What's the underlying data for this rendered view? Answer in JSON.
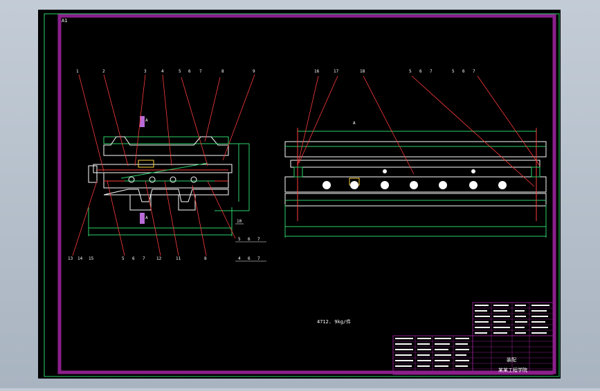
{
  "drawing": {
    "sheet_tag": "A1",
    "section_mark": "A",
    "view_label": "A",
    "weight_note": "4712. 9kg/件",
    "left_callouts_top": [
      "1",
      "2",
      "3",
      "4",
      "5",
      "6",
      "7",
      "8",
      "9"
    ],
    "left_callouts_bottom": [
      "13",
      "14",
      "15",
      "5",
      "6",
      "7",
      "12",
      "11",
      "8",
      "4",
      "6",
      "7"
    ],
    "left_callout_side": "10",
    "left_callout_side_group": [
      "5",
      "6",
      "7"
    ],
    "right_callouts_top": [
      "16",
      "17",
      "18",
      "5",
      "6",
      "7",
      "5",
      "6",
      "7"
    ],
    "title_block": {
      "company": "某某工程学院",
      "drawing_type": "装配"
    }
  },
  "colors": {
    "background": "#000000",
    "border": "#8b1f8b",
    "frame": "#2bd46a",
    "part": "#ffffff",
    "dimension": "#2bd46a",
    "leader": "#ff3b3b",
    "accent": "#b86bd6"
  }
}
